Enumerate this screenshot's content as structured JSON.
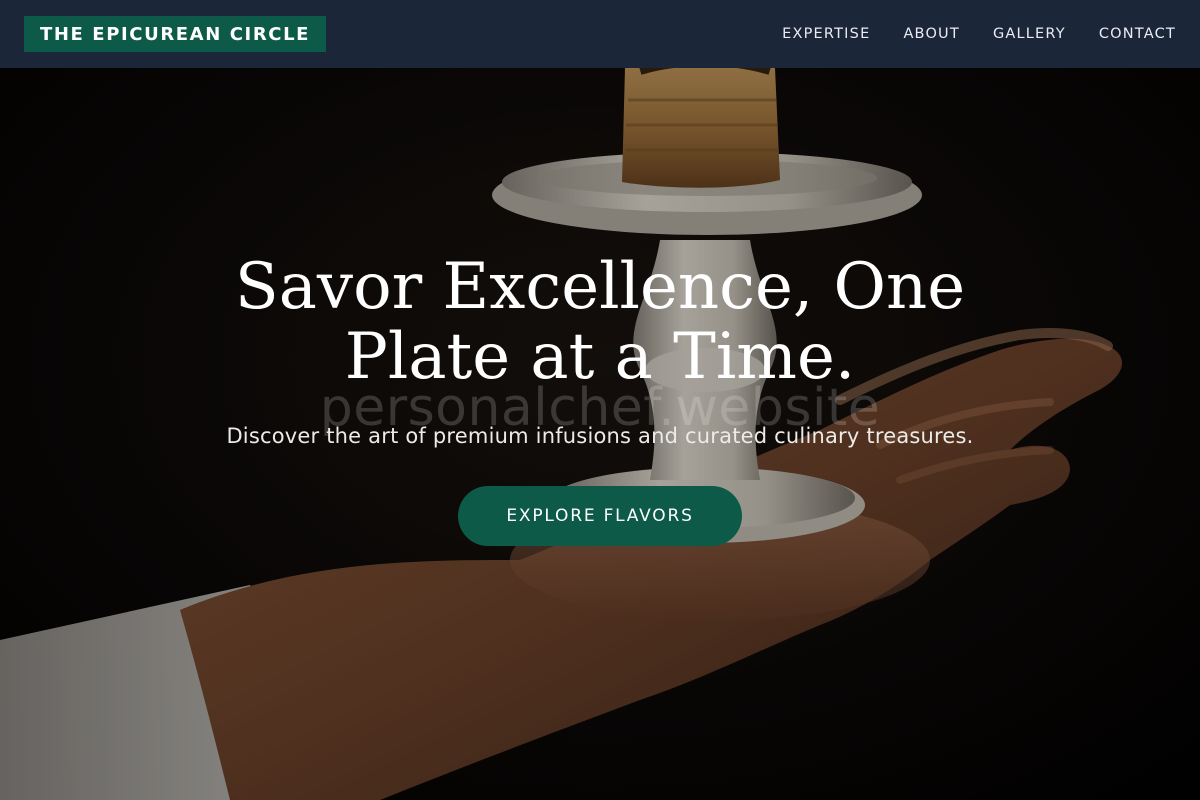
{
  "navbar": {
    "brand": "THE EPICUREAN CIRCLE",
    "links": [
      {
        "label": "EXPERTISE"
      },
      {
        "label": "ABOUT"
      },
      {
        "label": "GALLERY"
      },
      {
        "label": "CONTACT"
      }
    ]
  },
  "hero": {
    "headline": "Savor Excellence, One Plate at a Time.",
    "watermark": "personalchef.website",
    "subheadline": "Discover the art of premium infusions and curated culinary treasures.",
    "cta_label": "EXPLORE FLAVORS",
    "background_image": "hand-holding-pastry-on-cake-stand-photo"
  },
  "colors": {
    "navbar_bg": "#1c2639",
    "accent_green": "#0c5a47",
    "text_white": "#ffffff"
  }
}
